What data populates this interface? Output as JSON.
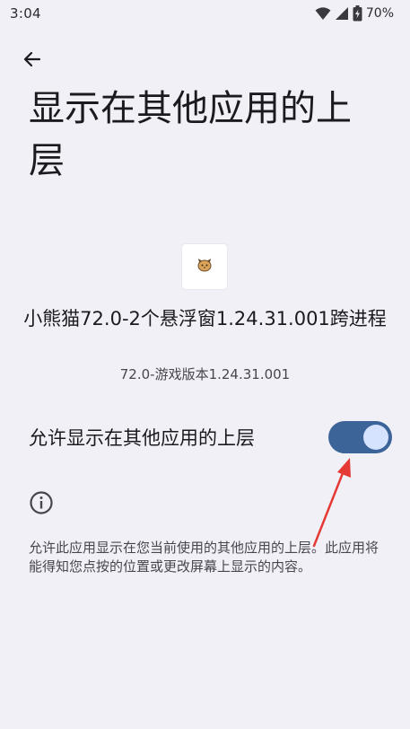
{
  "status_bar": {
    "time": "3:04",
    "battery": "70%",
    "icons": [
      "wifi-icon",
      "cellular-icon",
      "battery-icon"
    ]
  },
  "header": {
    "back_icon": "arrow-left-icon",
    "title": "显示在其他应用的上层"
  },
  "app": {
    "icon": "app-cat-icon",
    "name": "小熊猫72.0-2个悬浮窗1.24.31.001跨进程",
    "version": "72.0-游戏版本1.24.31.001"
  },
  "permission": {
    "label": "允许显示在其他应用的上层",
    "enabled": true
  },
  "info": {
    "icon": "info-icon",
    "description": "允许此应用显示在您当前使用的其他应用的上层。此应用将能得知您点按的位置或更改屏幕上显示的内容。"
  },
  "annotation": {
    "arrow_color": "#e53935"
  },
  "colors": {
    "background": "#f2f0f7",
    "switch_track": "#3c6499",
    "switch_thumb": "#d6e3ff"
  }
}
